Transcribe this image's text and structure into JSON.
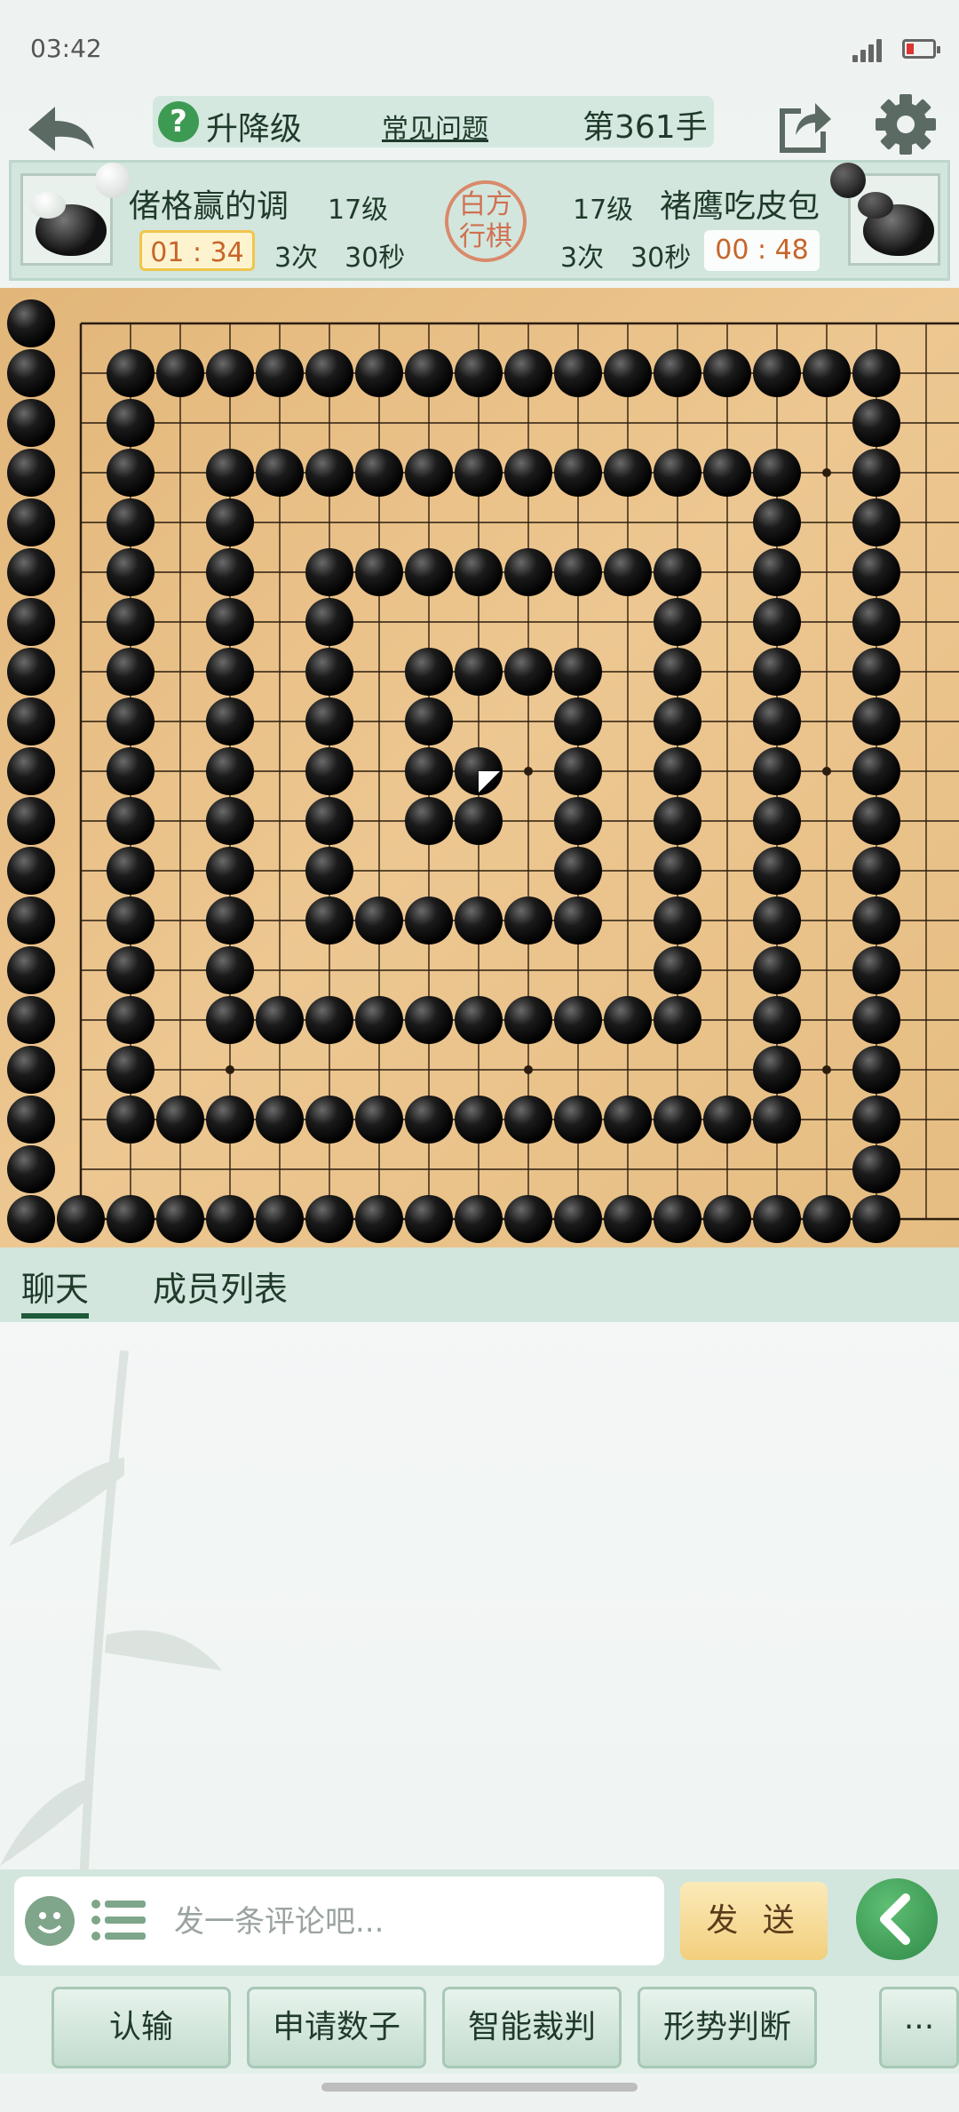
{
  "status_bar": {
    "time": "03:42"
  },
  "header": {
    "rank_label": "升降级",
    "help_icon_glyph": "?",
    "faq_link": "常见问题",
    "move_counter": "第361手"
  },
  "players": {
    "white": {
      "name": "偖格赢的调",
      "rank": "17级",
      "clock": "01 : 34",
      "periods": "3次　30秒"
    },
    "black": {
      "name": "褚鹰吃皮包",
      "rank": "17级",
      "clock": "00 : 48",
      "periods": "3次　30秒"
    },
    "turn_seal": {
      "line1": "白方",
      "line2": "行棋"
    }
  },
  "board": {
    "size": 19,
    "star_points": [
      [
        3,
        3
      ],
      [
        3,
        9
      ],
      [
        3,
        15
      ],
      [
        9,
        3
      ],
      [
        9,
        9
      ],
      [
        9,
        15
      ],
      [
        15,
        3
      ],
      [
        15,
        9
      ],
      [
        15,
        15
      ]
    ],
    "black_stones": [
      [
        -1,
        0
      ],
      [
        -1,
        1
      ],
      [
        -1,
        2
      ],
      [
        -1,
        3
      ],
      [
        -1,
        4
      ],
      [
        -1,
        5
      ],
      [
        -1,
        6
      ],
      [
        -1,
        7
      ],
      [
        -1,
        8
      ],
      [
        -1,
        9
      ],
      [
        -1,
        10
      ],
      [
        -1,
        11
      ],
      [
        -1,
        12
      ],
      [
        -1,
        13
      ],
      [
        -1,
        14
      ],
      [
        -1,
        15
      ],
      [
        -1,
        16
      ],
      [
        -1,
        17
      ],
      [
        -1,
        18
      ],
      [
        0,
        18
      ],
      [
        1,
        18
      ],
      [
        2,
        18
      ],
      [
        3,
        18
      ],
      [
        4,
        18
      ],
      [
        5,
        18
      ],
      [
        6,
        18
      ],
      [
        7,
        18
      ],
      [
        8,
        18
      ],
      [
        9,
        18
      ],
      [
        10,
        18
      ],
      [
        11,
        18
      ],
      [
        12,
        18
      ],
      [
        13,
        18
      ],
      [
        14,
        18
      ],
      [
        15,
        18
      ],
      [
        16,
        18
      ],
      [
        1,
        1
      ],
      [
        2,
        1
      ],
      [
        3,
        1
      ],
      [
        4,
        1
      ],
      [
        5,
        1
      ],
      [
        6,
        1
      ],
      [
        7,
        1
      ],
      [
        8,
        1
      ],
      [
        9,
        1
      ],
      [
        10,
        1
      ],
      [
        11,
        1
      ],
      [
        12,
        1
      ],
      [
        13,
        1
      ],
      [
        14,
        1
      ],
      [
        15,
        1
      ],
      [
        16,
        1
      ],
      [
        16,
        2
      ],
      [
        16,
        3
      ],
      [
        16,
        4
      ],
      [
        16,
        5
      ],
      [
        16,
        6
      ],
      [
        16,
        7
      ],
      [
        16,
        8
      ],
      [
        16,
        9
      ],
      [
        16,
        10
      ],
      [
        16,
        11
      ],
      [
        16,
        12
      ],
      [
        16,
        13
      ],
      [
        16,
        14
      ],
      [
        16,
        15
      ],
      [
        16,
        16
      ],
      [
        16,
        17
      ],
      [
        1,
        2
      ],
      [
        1,
        3
      ],
      [
        1,
        4
      ],
      [
        1,
        5
      ],
      [
        1,
        6
      ],
      [
        1,
        7
      ],
      [
        1,
        8
      ],
      [
        1,
        9
      ],
      [
        1,
        10
      ],
      [
        1,
        11
      ],
      [
        1,
        12
      ],
      [
        1,
        13
      ],
      [
        1,
        14
      ],
      [
        1,
        15
      ],
      [
        1,
        16
      ],
      [
        2,
        16
      ],
      [
        3,
        16
      ],
      [
        4,
        16
      ],
      [
        5,
        16
      ],
      [
        6,
        16
      ],
      [
        7,
        16
      ],
      [
        8,
        16
      ],
      [
        9,
        16
      ],
      [
        10,
        16
      ],
      [
        11,
        16
      ],
      [
        12,
        16
      ],
      [
        13,
        16
      ],
      [
        14,
        16
      ],
      [
        3,
        3
      ],
      [
        4,
        3
      ],
      [
        5,
        3
      ],
      [
        6,
        3
      ],
      [
        7,
        3
      ],
      [
        8,
        3
      ],
      [
        9,
        3
      ],
      [
        10,
        3
      ],
      [
        11,
        3
      ],
      [
        12,
        3
      ],
      [
        13,
        3
      ],
      [
        14,
        3
      ],
      [
        14,
        4
      ],
      [
        14,
        5
      ],
      [
        14,
        6
      ],
      [
        14,
        7
      ],
      [
        14,
        8
      ],
      [
        14,
        9
      ],
      [
        14,
        10
      ],
      [
        14,
        11
      ],
      [
        14,
        12
      ],
      [
        14,
        13
      ],
      [
        14,
        14
      ],
      [
        14,
        15
      ],
      [
        3,
        4
      ],
      [
        3,
        5
      ],
      [
        3,
        6
      ],
      [
        3,
        7
      ],
      [
        3,
        8
      ],
      [
        3,
        9
      ],
      [
        3,
        10
      ],
      [
        3,
        11
      ],
      [
        3,
        12
      ],
      [
        3,
        13
      ],
      [
        3,
        14
      ],
      [
        4,
        14
      ],
      [
        5,
        14
      ],
      [
        6,
        14
      ],
      [
        7,
        14
      ],
      [
        8,
        14
      ],
      [
        9,
        14
      ],
      [
        10,
        14
      ],
      [
        11,
        14
      ],
      [
        12,
        14
      ],
      [
        5,
        5
      ],
      [
        6,
        5
      ],
      [
        7,
        5
      ],
      [
        8,
        5
      ],
      [
        9,
        5
      ],
      [
        10,
        5
      ],
      [
        11,
        5
      ],
      [
        12,
        5
      ],
      [
        12,
        6
      ],
      [
        12,
        7
      ],
      [
        12,
        8
      ],
      [
        12,
        9
      ],
      [
        12,
        10
      ],
      [
        12,
        11
      ],
      [
        12,
        12
      ],
      [
        12,
        13
      ],
      [
        5,
        6
      ],
      [
        5,
        7
      ],
      [
        5,
        8
      ],
      [
        5,
        9
      ],
      [
        5,
        10
      ],
      [
        5,
        11
      ],
      [
        5,
        12
      ],
      [
        6,
        12
      ],
      [
        7,
        12
      ],
      [
        8,
        12
      ],
      [
        9,
        12
      ],
      [
        10,
        12
      ],
      [
        7,
        7
      ],
      [
        8,
        7
      ],
      [
        9,
        7
      ],
      [
        10,
        7
      ],
      [
        10,
        8
      ],
      [
        10,
        9
      ],
      [
        10,
        10
      ],
      [
        10,
        11
      ],
      [
        7,
        8
      ],
      [
        7,
        9
      ],
      [
        7,
        10
      ],
      [
        8,
        10
      ],
      [
        8,
        9
      ]
    ],
    "last_move": [
      8,
      9
    ]
  },
  "tabs": {
    "chat": "聊天",
    "members": "成员列表"
  },
  "input": {
    "placeholder": "发一条评论吧...",
    "send_label": "发 送"
  },
  "bottom_buttons": {
    "resign": "认输",
    "count": "申请数子",
    "judge": "智能裁判",
    "evaluate": "形势判断",
    "more": "···"
  },
  "colors": {
    "accent": "#3d9a52",
    "panel": "#d2e6dd",
    "board": "#e8c184",
    "clock_text": "#c8652a"
  }
}
